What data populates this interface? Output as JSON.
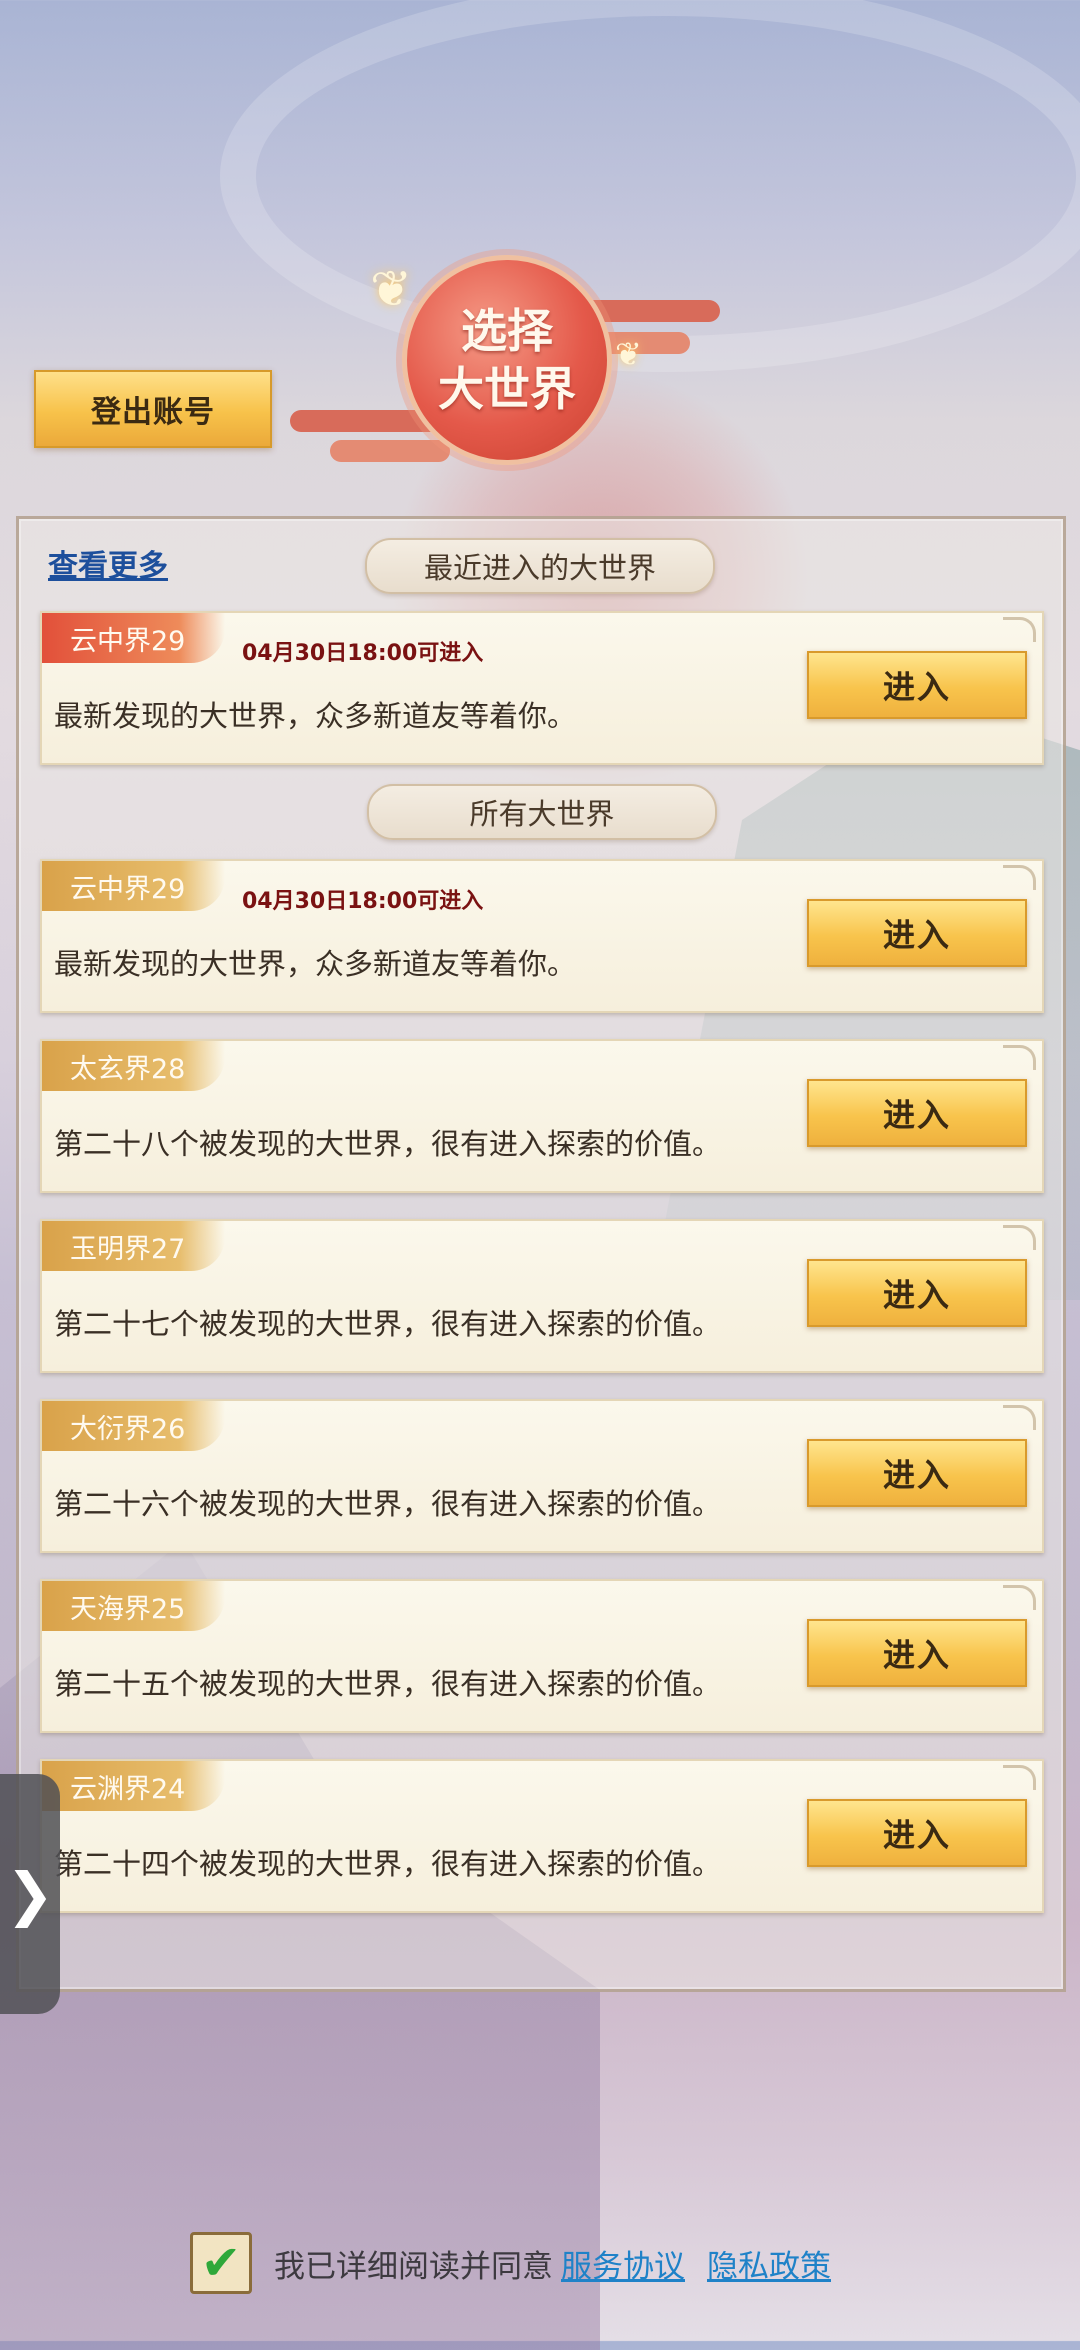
{
  "header": {
    "logout_label": "登出账号",
    "emblem_text_line1": "选择",
    "emblem_text_line2": "大世界"
  },
  "panel": {
    "see_more_label": "查看更多",
    "recent_section_title": "最近进入的大世界",
    "all_section_title": "所有大世界"
  },
  "recent": [
    {
      "name": "云中界29",
      "open_time": "04月30日18:00可进入",
      "desc": "最新发现的大世界，众多新道友等着你。",
      "enter_label": "进入"
    }
  ],
  "worlds": [
    {
      "name": "云中界29",
      "open_time": "04月30日18:00可进入",
      "desc": "最新发现的大世界，众多新道友等着你。",
      "enter_label": "进入"
    },
    {
      "name": "太玄界28",
      "desc": "第二十八个被发现的大世界，很有进入探索的价值。",
      "enter_label": "进入"
    },
    {
      "name": "玉明界27",
      "desc": "第二十七个被发现的大世界，很有进入探索的价值。",
      "enter_label": "进入"
    },
    {
      "name": "大衍界26",
      "desc": "第二十六个被发现的大世界，很有进入探索的价值。",
      "enter_label": "进入"
    },
    {
      "name": "天海界25",
      "desc": "第二十五个被发现的大世界，很有进入探索的价值。",
      "enter_label": "进入"
    },
    {
      "name": "云渊界24",
      "desc": "第二十四个被发现的大世界，很有进入探索的价值。",
      "enter_label": "进入"
    }
  ],
  "side_tab": {
    "icon": "chevron-right-icon",
    "glyph": "❯"
  },
  "footer": {
    "checkbox_checked": true,
    "checkbox_glyph": "✔",
    "agree_text": "我已详细阅读并同意",
    "service_link": "服务协议",
    "privacy_link": "隐私政策"
  },
  "colors": {
    "button_gold": "#f8c44c",
    "tag_hot": "#e2503a",
    "tag_gold": "#d9a24a",
    "link_blue": "#1f82c8",
    "open_time_red": "#7a1212"
  }
}
